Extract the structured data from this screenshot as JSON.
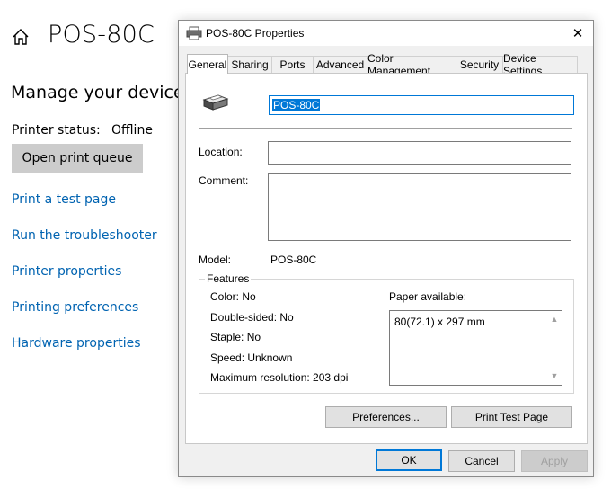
{
  "settings": {
    "title": "POS-80C",
    "section_title": "Manage your device",
    "status_label": "Printer status:",
    "status_value": "Offline",
    "open_queue_label": "Open print queue",
    "links": [
      "Print a test page",
      "Run the troubleshooter",
      "Printer properties",
      "Printing preferences",
      "Hardware properties"
    ],
    "link_color": "#0063b1"
  },
  "dialog": {
    "title": "POS-80C Properties",
    "close_glyph": "✕",
    "tabs": [
      "General",
      "Sharing",
      "Ports",
      "Advanced",
      "Color Management",
      "Security",
      "Device Settings"
    ],
    "active_tab": "General",
    "printer_name": "POS-80C",
    "location_label": "Location:",
    "location_value": "",
    "comment_label": "Comment:",
    "comment_value": "",
    "model_label": "Model:",
    "model_value": "POS-80C",
    "features_title": "Features",
    "features": {
      "color": "Color: No",
      "double_sided": "Double-sided: No",
      "staple": "Staple: No",
      "speed": "Speed: Unknown",
      "max_resolution": "Maximum resolution: 203 dpi"
    },
    "paper_label": "Paper available:",
    "paper_items": [
      "80(72.1) x 297 mm"
    ],
    "preferences_button": "Preferences...",
    "print_test_button": "Print Test Page",
    "ok_button": "OK",
    "cancel_button": "Cancel",
    "apply_button": "Apply",
    "accent_color": "#0078d7"
  }
}
